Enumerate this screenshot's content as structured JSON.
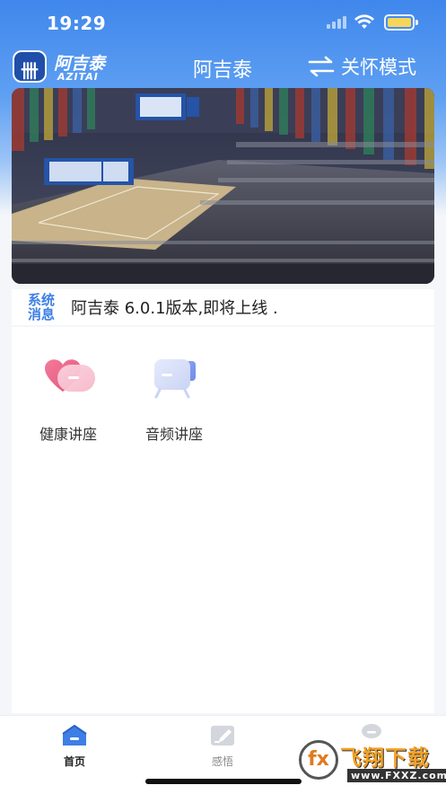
{
  "status_bar": {
    "time": "19:29",
    "battery_color": "#f6d65a"
  },
  "header": {
    "logo_cn": "阿吉泰",
    "logo_en": "AZITAI",
    "title": "阿吉泰",
    "care_mode_label": "关怀模式",
    "swap_icon": "swap-arrows-icon"
  },
  "banner": {
    "image": "lecture-hall-photo"
  },
  "notice": {
    "tag_line1": "系统",
    "tag_line2": "消息",
    "text": "阿吉泰 6.0.1版本,即将上线 ."
  },
  "features": [
    {
      "label": "健康讲座",
      "icon": "heart-card-icon"
    },
    {
      "label": "音频讲座",
      "icon": "video-camera-icon"
    }
  ],
  "tabs": [
    {
      "label": "首页",
      "icon": "home-icon",
      "active": true
    },
    {
      "label": "感悟",
      "icon": "note-edit-icon",
      "active": false
    },
    {
      "label": "",
      "icon": "profile-icon",
      "active": false
    }
  ],
  "watermark": {
    "title": "飞翔下载",
    "url": "www.FXXZ.com",
    "badge": "fx"
  },
  "colors": {
    "accent": "#3d7fe6",
    "header_top": "#3f87ec"
  }
}
